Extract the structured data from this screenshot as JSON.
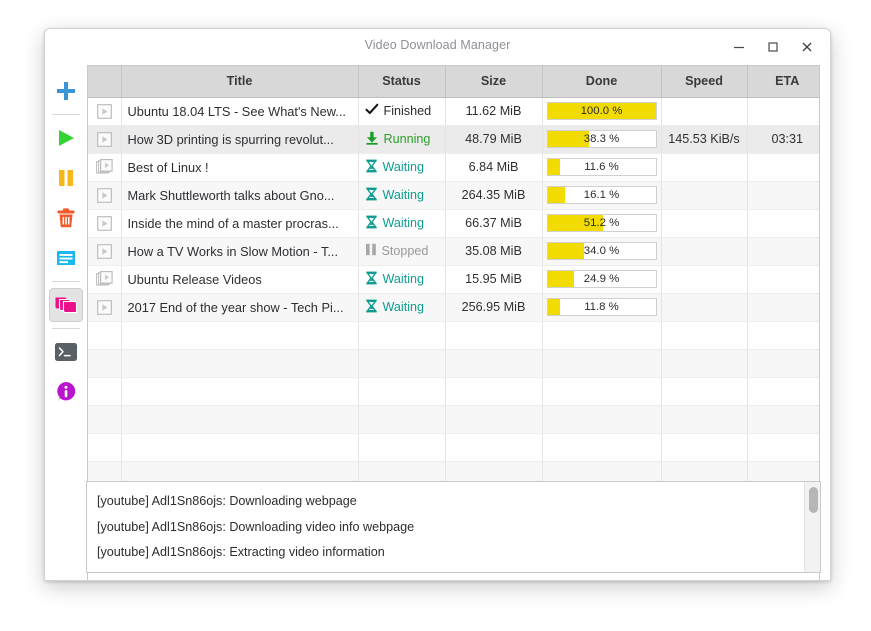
{
  "window": {
    "title": "Video Download Manager",
    "controls": [
      {
        "name": "minimize",
        "glyph": "minimize-icon"
      },
      {
        "name": "maximize",
        "glyph": "maximize-icon"
      },
      {
        "name": "close",
        "glyph": "close-icon"
      }
    ]
  },
  "sidebar": {
    "items": [
      {
        "name": "add-download",
        "icon": "plus-icon",
        "color": "#3a95d6",
        "active": false
      },
      {
        "name": "start-download",
        "icon": "play-icon",
        "color": "#35d435",
        "active": false
      },
      {
        "name": "pause-download",
        "icon": "pause-icon",
        "color": "#f5b719",
        "active": false
      },
      {
        "name": "delete-download",
        "icon": "trash-icon",
        "color": "#f25a2b",
        "active": false
      },
      {
        "name": "properties",
        "icon": "document-icon",
        "color": "#19b9f0",
        "active": false
      },
      {
        "name": "batch-download",
        "icon": "copies-icon",
        "color": "#ec0f8c",
        "active": true
      },
      {
        "name": "console",
        "icon": "terminal-icon",
        "color": "#5a6166",
        "active": false
      },
      {
        "name": "about",
        "icon": "info-icon",
        "color": "#bb14cf",
        "active": false
      }
    ]
  },
  "table": {
    "columns": [
      "",
      "Title",
      "Status",
      "Size",
      "Done",
      "Speed",
      "ETA"
    ],
    "rows": [
      {
        "icon": "video-icon",
        "title": "Ubuntu 18.04 LTS - See What's New...",
        "status": "Finished",
        "status_kind": "finished",
        "status_icon": "check-icon",
        "size": "11.62 MiB",
        "percent": 100.0,
        "done": "100.0 %",
        "speed": "",
        "eta": "",
        "selected": false
      },
      {
        "icon": "video-icon",
        "title": "How 3D printing is spurring revolut...",
        "status": "Running",
        "status_kind": "running",
        "status_icon": "download-icon",
        "size": "48.79 MiB",
        "percent": 38.3,
        "done": "38.3 %",
        "speed": "145.53 KiB/s",
        "eta": "03:31",
        "selected": true
      },
      {
        "icon": "playlist-icon",
        "title": "Best of Linux !",
        "status": "Waiting",
        "status_kind": "waiting",
        "status_icon": "hourglass-icon",
        "size": "6.84 MiB",
        "percent": 11.6,
        "done": "11.6 %",
        "speed": "",
        "eta": "",
        "selected": false
      },
      {
        "icon": "video-icon",
        "title": "Mark Shuttleworth talks about Gno...",
        "status": "Waiting",
        "status_kind": "waiting",
        "status_icon": "hourglass-icon",
        "size": "264.35 MiB",
        "percent": 16.1,
        "done": "16.1 %",
        "speed": "",
        "eta": "",
        "selected": false
      },
      {
        "icon": "video-icon",
        "title": "Inside the mind of a master procras...",
        "status": "Waiting",
        "status_kind": "waiting",
        "status_icon": "hourglass-icon",
        "size": "66.37 MiB",
        "percent": 51.2,
        "done": "51.2 %",
        "speed": "",
        "eta": "",
        "selected": false
      },
      {
        "icon": "video-icon",
        "title": "How a TV Works in Slow Motion - T...",
        "status": "Stopped",
        "status_kind": "stopped",
        "status_icon": "pause-icon",
        "size": "35.08 MiB",
        "percent": 34.0,
        "done": "34.0 %",
        "speed": "",
        "eta": "",
        "selected": false
      },
      {
        "icon": "playlist-icon",
        "title": "Ubuntu Release Videos",
        "status": "Waiting",
        "status_kind": "waiting",
        "status_icon": "hourglass-icon",
        "size": "15.95 MiB",
        "percent": 24.9,
        "done": "24.9 %",
        "speed": "",
        "eta": "",
        "selected": false
      },
      {
        "icon": "video-icon",
        "title": "2017 End of the year show - Tech Pi...",
        "status": "Waiting",
        "status_kind": "waiting",
        "status_icon": "hourglass-icon",
        "size": "256.95 MiB",
        "percent": 11.8,
        "done": "11.8 %",
        "speed": "",
        "eta": "",
        "selected": false
      }
    ],
    "empty_rows": 6
  },
  "log": {
    "lines": [
      "[youtube] Adl1Sn86ojs: Downloading webpage",
      "[youtube] Adl1Sn86ojs: Downloading video info webpage",
      "[youtube] Adl1Sn86ojs: Extracting video information"
    ]
  },
  "colors": {
    "progress_fill": "#F2DB00",
    "header_bg": "#d8d8d8",
    "running": "#2aa02a",
    "waiting": "#0e9c92",
    "stopped": "#9a9a9e"
  }
}
